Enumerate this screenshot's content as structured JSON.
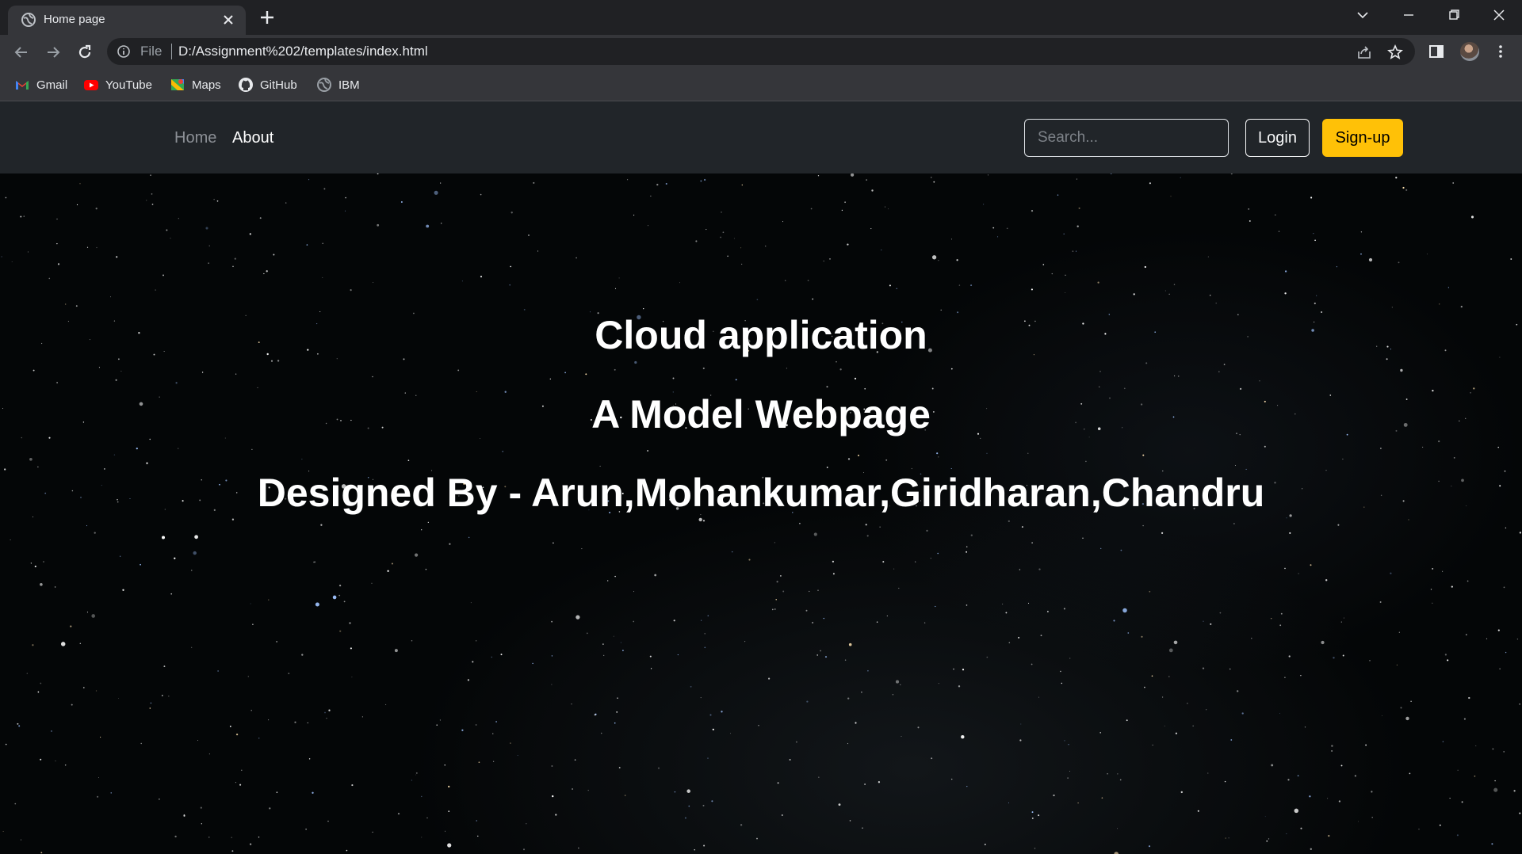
{
  "browser": {
    "tab_title": "Home page",
    "url_scheme": "File",
    "url": "D:/Assignment%202/templates/index.html",
    "bookmarks": [
      {
        "label": "Gmail",
        "icon": "gmail-icon"
      },
      {
        "label": "YouTube",
        "icon": "youtube-icon"
      },
      {
        "label": "Maps",
        "icon": "maps-icon"
      },
      {
        "label": "GitHub",
        "icon": "github-icon"
      },
      {
        "label": "IBM",
        "icon": "globe-icon"
      }
    ]
  },
  "navbar": {
    "links": [
      {
        "label": "Home"
      },
      {
        "label": "About"
      }
    ],
    "search_placeholder": "Search...",
    "login_label": "Login",
    "signup_label": "Sign-up"
  },
  "hero": {
    "title": "Cloud application",
    "subtitle": "A Model Webpage",
    "credits": "Designed By - Arun,Mohankumar,Giridharan,Chandru"
  },
  "colors": {
    "navbar_bg": "#212529",
    "signup_accent": "#ffc107",
    "chrome_bg": "#35363a"
  }
}
